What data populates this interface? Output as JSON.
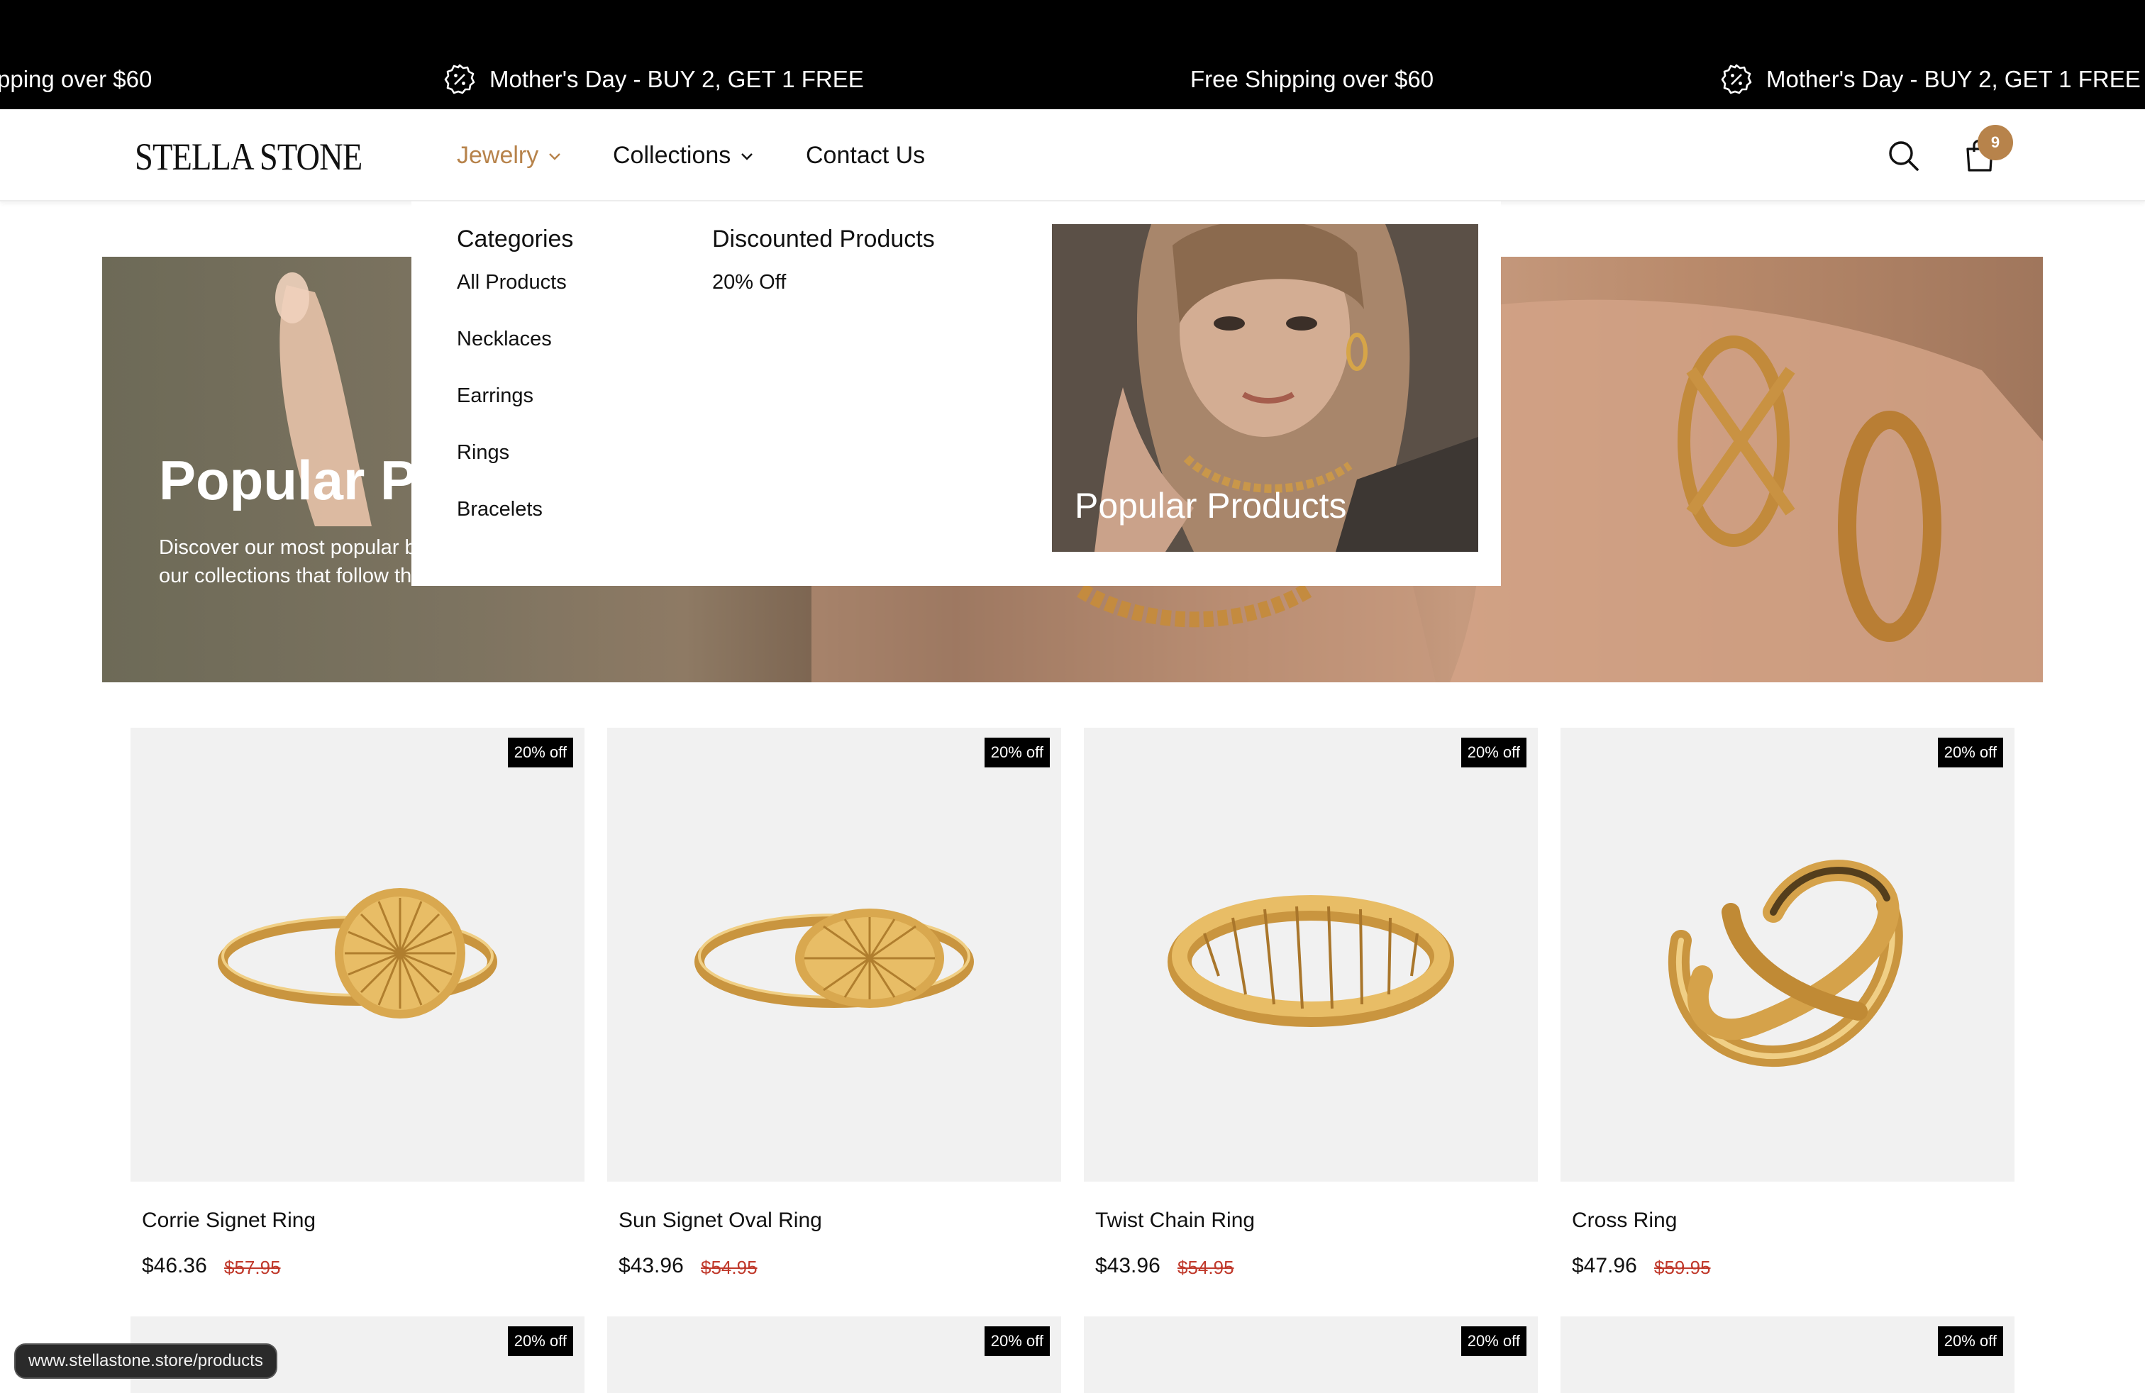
{
  "announcement": {
    "items": [
      {
        "text": "pping over $60",
        "icon": ""
      },
      {
        "text": "Mother's Day - BUY 2, GET 1 FREE",
        "icon": "discount-badge-icon"
      },
      {
        "text": "Free Shipping over $60",
        "icon": ""
      },
      {
        "text": "Mother's Day - BUY 2, GET 1 FREE",
        "icon": "discount-badge-icon"
      }
    ]
  },
  "header": {
    "logo": "STELLA STONE",
    "nav": [
      {
        "label": "Jewelry",
        "has_dropdown": true,
        "active": true
      },
      {
        "label": "Collections",
        "has_dropdown": true,
        "active": false
      },
      {
        "label": "Contact Us",
        "has_dropdown": false,
        "active": false
      }
    ],
    "cart_count": "9",
    "icons": [
      "search-icon",
      "shopping-bag-icon"
    ]
  },
  "mega_menu": {
    "categories_heading": "Categories",
    "categories": [
      "All Products",
      "Necklaces",
      "Earrings",
      "Rings",
      "Bracelets"
    ],
    "discounted_heading": "Discounted Products",
    "discounted": [
      "20% Off"
    ],
    "feature_label": "Popular Products"
  },
  "hero": {
    "title": "Popular Pr",
    "description": "Discover our most popular beloved favorites have bee the best of our collections that follow the latest trends and timeless classics."
  },
  "products": [
    {
      "name": "Corrie Signet Ring",
      "price": "$46.36",
      "compare_price": "$57.95",
      "badge": "20% off"
    },
    {
      "name": "Sun Signet Oval Ring",
      "price": "$43.96",
      "compare_price": "$54.95",
      "badge": "20% off"
    },
    {
      "name": "Twist Chain Ring",
      "price": "$43.96",
      "compare_price": "$54.95",
      "badge": "20% off"
    },
    {
      "name": "Cross Ring",
      "price": "$47.96",
      "compare_price": "$59.95",
      "badge": "20% off"
    }
  ],
  "products_next_row": [
    {
      "badge": "20% off"
    },
    {
      "badge": "20% off"
    },
    {
      "badge": "20% off"
    },
    {
      "badge": "20% off"
    }
  ],
  "status_bar": {
    "url": "www.stellastone.store/products"
  },
  "colors": {
    "accent": "#b7834b",
    "announcement_bg": "#000000",
    "sale_price": "#c0392b",
    "card_bg": "#f1f1f1"
  }
}
